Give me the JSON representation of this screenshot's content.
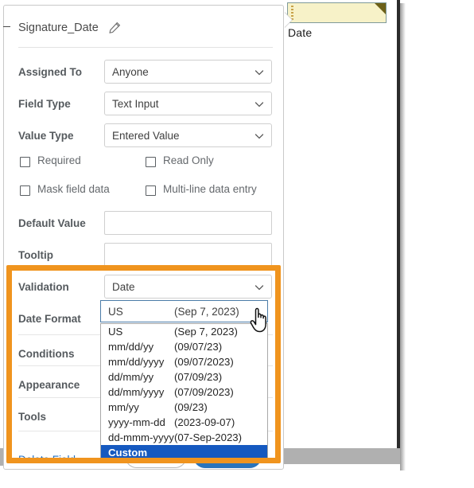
{
  "document": {
    "field_label": "Date",
    "field_name": "date-form-field"
  },
  "panel": {
    "title": "Signature_Date",
    "edit_icon": "pencil-icon",
    "rows": [
      {
        "label": "Assigned To",
        "value": "Anyone",
        "control": "select"
      },
      {
        "label": "Field Type",
        "value": "Text Input",
        "control": "select"
      },
      {
        "label": "Value Type",
        "value": "Entered Value",
        "control": "select"
      }
    ],
    "checkboxes": [
      {
        "label": "Required",
        "checked": false
      },
      {
        "label": "Read Only",
        "checked": false
      },
      {
        "label": "Mask field data",
        "checked": false
      },
      {
        "label": "Multi-line data entry",
        "checked": false
      }
    ],
    "text_fields": [
      {
        "label": "Default Value",
        "value": "",
        "placeholder": ""
      },
      {
        "label": "Tooltip",
        "value": "",
        "placeholder": ""
      }
    ],
    "validation": {
      "label": "Validation",
      "value": "Date"
    },
    "date_format": {
      "label": "Date Format",
      "selected_key": "US",
      "selected_value": "(Sep 7, 2023)",
      "options": [
        {
          "key": "US",
          "sample": "(Sep 7, 2023)",
          "selected": false
        },
        {
          "key": "mm/dd/yy",
          "sample": "(09/07/23)",
          "selected": false
        },
        {
          "key": "mm/dd/yyyy",
          "sample": "(09/07/2023)",
          "selected": false
        },
        {
          "key": "dd/mm/yy",
          "sample": "(07/09/23)",
          "selected": false
        },
        {
          "key": "dd/mm/yyyy",
          "sample": "(07/09/2023)",
          "selected": false
        },
        {
          "key": "mm/yy",
          "sample": "(09/23)",
          "selected": false
        },
        {
          "key": "yyyy-mm-dd",
          "sample": "(2023-09-07)",
          "selected": false
        },
        {
          "key": "dd-mmm-yyyy",
          "sample": "(07-Sep-2023)",
          "selected": false
        },
        {
          "key": "Custom",
          "sample": "",
          "selected": true
        }
      ]
    },
    "sections": [
      {
        "label": "Conditions"
      },
      {
        "label": "Appearance"
      },
      {
        "label": "Tools"
      }
    ],
    "delete_link": "Delete Field",
    "buttons": {
      "cancel_label": "",
      "save_label": ""
    }
  },
  "colors": {
    "highlight_orange": "#f0941e",
    "link_blue": "#1f6fc4",
    "selection_blue": "#1559c0",
    "save_button_blue": "#2a74bb",
    "field_yellow": "#f7f2c8"
  },
  "cursor": {
    "type": "pointing-hand-cursor"
  }
}
